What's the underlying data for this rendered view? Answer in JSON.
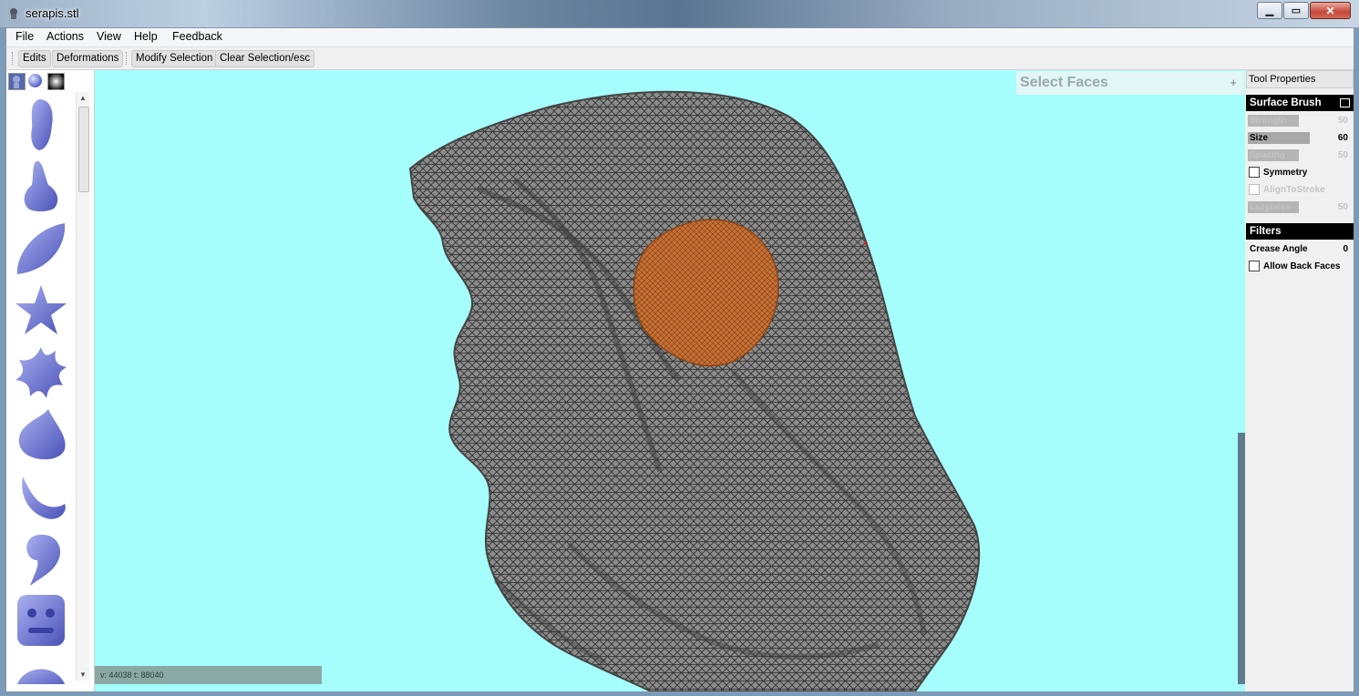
{
  "window": {
    "title": "serapis.stl",
    "controls": [
      "minimize",
      "maximize",
      "close"
    ]
  },
  "menu": [
    "File",
    "Actions",
    "View",
    "Help",
    "Feedback"
  ],
  "toolbar": {
    "edits": "Edits",
    "deformations": "Deformations",
    "modify_selection": "Modify Selection",
    "clear_selection": "Clear Selection/esc"
  },
  "palette": {
    "tabs": [
      "bust-tab-icon",
      "sphere-tab-icon",
      "gradient-tab-icon"
    ],
    "items": [
      "face-mask-stamp",
      "nose-stamp",
      "leaf-stamp",
      "star-stamp",
      "splat-stamp",
      "crescent-stamp",
      "claw-stamp",
      "comma-stamp",
      "gargoyle-face-stamp",
      "dome-stamp"
    ]
  },
  "viewport": {
    "select_panel_title": "Select Faces",
    "select_panel_expand": "+",
    "status": "v: 44038  t: 88040",
    "colors": {
      "background": "#a5fdfc",
      "mesh": "#6e6e6e",
      "selection": "#d87a35"
    }
  },
  "tool_properties": {
    "title": "Tool Properties",
    "surface_brush": {
      "header": "Surface Brush",
      "strength_label": "Strength",
      "strength_value": "50",
      "size_label": "Size",
      "size_value": "60",
      "spacing_label": "Spacing",
      "spacing_value": "50",
      "symmetry_label": "Symmetry",
      "align_label": "AlignToStroke",
      "lazyness_label": "Lazyness",
      "lazyness_value": "50"
    },
    "filters": {
      "header": "Filters",
      "crease_label": "Crease Angle",
      "crease_value": "0",
      "back_faces_label": "Allow Back Faces"
    }
  }
}
